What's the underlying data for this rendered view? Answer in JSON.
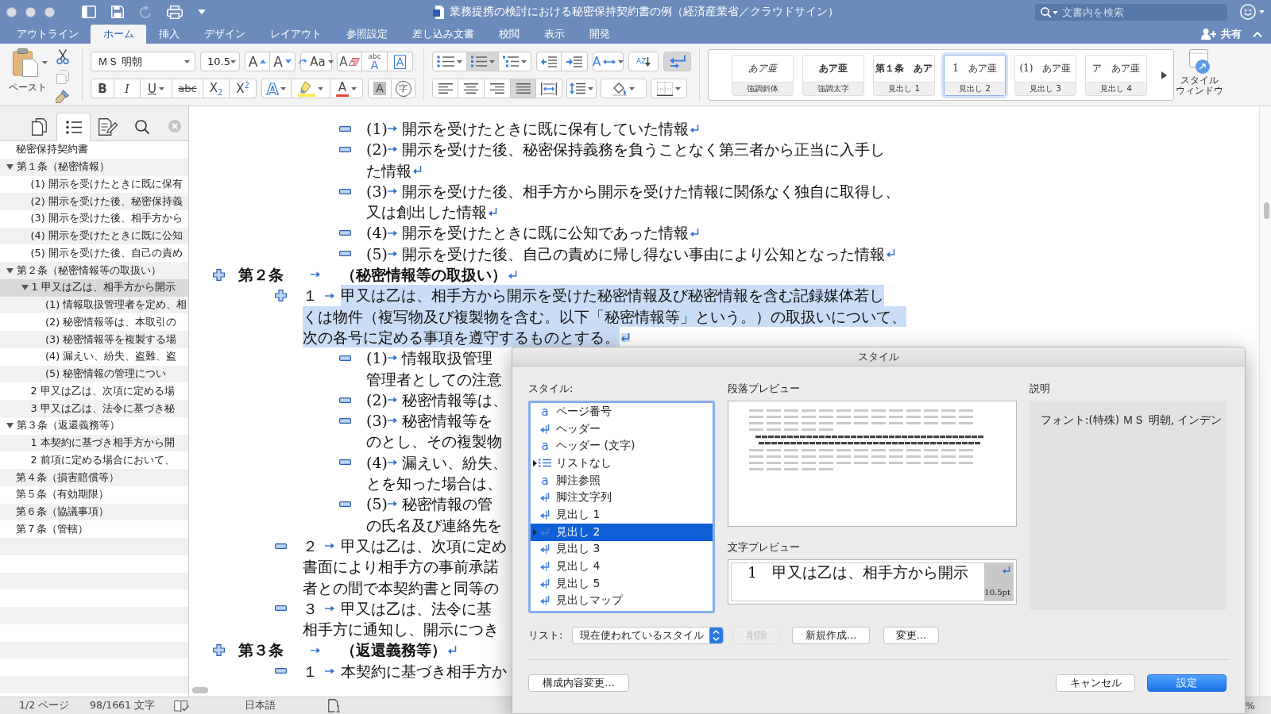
{
  "window": {
    "title": "業務提携の検討における秘密保持契約書の例（経済産業省／クラウドサイン）",
    "search": {
      "placeholder": "文書内を検索"
    }
  },
  "quick_access": [
    {
      "kind": "sidebar",
      "disabled": false
    },
    {
      "kind": "save",
      "disabled": false
    },
    {
      "kind": "undo",
      "disabled": true
    },
    {
      "kind": "print",
      "disabled": false
    },
    {
      "kind": "customize",
      "disabled": false
    }
  ],
  "tabs": [
    {
      "label": "アウトライン",
      "selected": false
    },
    {
      "label": "ホーム",
      "selected": true
    },
    {
      "label": "挿入",
      "selected": false
    },
    {
      "label": "デザイン",
      "selected": false
    },
    {
      "label": "レイアウト",
      "selected": false
    },
    {
      "label": "参照設定",
      "selected": false
    },
    {
      "label": "差し込み文書",
      "selected": false
    },
    {
      "label": "校閲",
      "selected": false
    },
    {
      "label": "表示",
      "selected": false
    },
    {
      "label": "開発",
      "selected": false
    }
  ],
  "share": {
    "label": "共有"
  },
  "ribbon": {
    "paste": {
      "label": "ペースト"
    },
    "font": {
      "name": "ＭＳ 明朝",
      "size": "10.5",
      "row1": [
        [
          {
            "kind": "grow",
            "label": "A"
          },
          {
            "kind": "shrink",
            "label": "A"
          }
        ],
        [
          {
            "kind": "change_case",
            "label": "Aa",
            "dropdown": true
          }
        ],
        [
          {
            "kind": "clear_formatting",
            "label": "A"
          },
          {
            "kind": "phonetic",
            "label": "A",
            "ruby": "abc"
          },
          {
            "kind": "char_border",
            "label": "A"
          }
        ]
      ],
      "row2": [
        [
          {
            "kind": "bold",
            "label": "B",
            "on": false
          },
          {
            "kind": "italic",
            "label": "I",
            "on": false
          },
          {
            "kind": "underline",
            "label": "U",
            "on": false,
            "dropdown": true
          },
          {
            "kind": "strike",
            "label": "abc",
            "on": false
          },
          {
            "kind": "subscript",
            "label": "X$_{2}$",
            "on": false
          },
          {
            "kind": "superscript",
            "label": "X$^{2}$",
            "on": false
          }
        ],
        [
          {
            "kind": "text_effects",
            "label": "A",
            "dropdown": true
          },
          {
            "kind": "highlight",
            "dropdown": true
          },
          {
            "kind": "font_color",
            "label": "A",
            "dropdown": true
          }
        ],
        [
          {
            "kind": "char_shading",
            "label": "A",
            "on": false
          },
          {
            "kind": "enclosed",
            "label": "字"
          }
        ]
      ]
    },
    "paragraph": {
      "row1": [
        [
          {
            "kind": "bullets",
            "dropdown": true,
            "on": false
          },
          {
            "kind": "numbering",
            "dropdown": true,
            "on": true
          },
          {
            "kind": "multilevel",
            "dropdown": true,
            "on": false
          }
        ],
        [
          {
            "kind": "outdent"
          },
          {
            "kind": "indent"
          }
        ],
        [
          {
            "kind": "asian_layout",
            "label": "A",
            "dropdown": true
          }
        ],
        [
          {
            "kind": "sort",
            "label": "AZ"
          }
        ],
        [
          {
            "kind": "show_marks",
            "on": true
          }
        ]
      ],
      "row2": [
        [
          {
            "kind": "align_left",
            "on": false
          },
          {
            "kind": "align_center",
            "on": false
          },
          {
            "kind": "align_right",
            "on": false
          },
          {
            "kind": "justify",
            "on": true
          },
          {
            "kind": "distribute",
            "on": false
          }
        ],
        [
          {
            "kind": "line_spacing",
            "dropdown": true
          }
        ],
        [
          {
            "kind": "shading",
            "dropdown": true
          }
        ],
        [
          {
            "kind": "borders",
            "dropdown": true
          }
        ]
      ]
    },
    "styles": [
      {
        "kind": "italic",
        "preview": "あア亜",
        "label": "強調斜体",
        "selected": false
      },
      {
        "kind": "bold",
        "preview": "あア亜",
        "label": "強調太字",
        "selected": false
      },
      {
        "kind": "bold",
        "preview": "第１条　あア",
        "label": "見出し 1",
        "selected": false
      },
      {
        "kind": "plain",
        "preview": "1　あア亜",
        "label": "見出し 2",
        "selected": true
      },
      {
        "kind": "plain",
        "preview": "(1)　あア亜",
        "label": "見出し 3",
        "selected": false
      },
      {
        "kind": "plain",
        "preview": "ア　あア亜",
        "label": "見出し 4",
        "selected": false
      }
    ],
    "style_window": {
      "label_lines": [
        "スタイル",
        "ウィンドウ"
      ]
    }
  },
  "sidebar": {
    "tabs": [
      {
        "kind": "thumbnails",
        "selected": false
      },
      {
        "kind": "outline",
        "selected": true
      },
      {
        "kind": "review",
        "selected": false
      },
      {
        "kind": "search",
        "selected": false
      }
    ],
    "outline": [
      {
        "text": "秘密保持契約書",
        "selected": false
      },
      {
        "text": "第１条（秘密情報）",
        "expanded": true,
        "selected": false,
        "children": [
          {
            "text": "(1) 開示を受けたときに既に保有",
            "selected": false
          },
          {
            "text": "(2) 開示を受けた後、秘密保持義",
            "selected": false
          },
          {
            "text": "(3) 開示を受けた後、相手方から",
            "selected": false
          },
          {
            "text": "(4) 開示を受けたときに既に公知",
            "selected": false
          },
          {
            "text": "(5) 開示を受けた後、自己の責め",
            "selected": false
          }
        ]
      },
      {
        "text": "第２条（秘密情報等の取扱い）",
        "expanded": true,
        "selected": false,
        "children": [
          {
            "text": "1 甲又は乙は、相手方から開示",
            "expanded": true,
            "selected": true,
            "children": [
              {
                "text": "(1) 情報取扱管理者を定め、相",
                "selected": false
              },
              {
                "text": "(2) 秘密情報等は、本取引の",
                "selected": false
              },
              {
                "text": "(3) 秘密情報等を複製する場",
                "selected": false
              },
              {
                "text": "(4) 漏えい、紛失、盗難、盗",
                "selected": false
              },
              {
                "text": "(5) 秘密情報の管理につい",
                "selected": false
              }
            ]
          },
          {
            "text": "2 甲又は乙は、次項に定める場",
            "selected": false
          },
          {
            "text": "3 甲又は乙は、法令に基づき秘",
            "selected": false
          }
        ]
      },
      {
        "text": "第３条（返還義務等）",
        "expanded": true,
        "selected": false,
        "children": [
          {
            "text": "1 本契約に基づき相手方から開",
            "selected": false
          },
          {
            "text": "2 前項に定める場合において、",
            "selected": false
          }
        ]
      },
      {
        "text": "第４条（損害賠償等）",
        "selected": false
      },
      {
        "text": "第５条（有効期限）",
        "selected": false
      },
      {
        "text": "第６条（協議事項）",
        "selected": false
      },
      {
        "text": "第７条（管轄）",
        "selected": false
      }
    ]
  },
  "document": {
    "blocks": [
      {
        "kind": "item",
        "has_subtext": false,
        "number": "(1)",
        "lines": [
          "開示を受けたときに既に保有していた情報"
        ],
        "end_mark": true,
        "selected": false
      },
      {
        "kind": "item",
        "has_subtext": false,
        "number": "(2)",
        "lines": [
          "開示を受けた後、秘密保持義務を負うことなく第三者から正当に入手し",
          "た情報"
        ],
        "end_mark": true,
        "selected": false
      },
      {
        "kind": "item",
        "has_subtext": false,
        "number": "(3)",
        "lines": [
          "開示を受けた後、相手方から開示を受けた情報に関係なく独自に取得し、",
          "又は創出した情報"
        ],
        "end_mark": true,
        "selected": false
      },
      {
        "kind": "item",
        "has_subtext": false,
        "number": "(4)",
        "lines": [
          "開示を受けたときに既に公知であった情報"
        ],
        "end_mark": true,
        "selected": false
      },
      {
        "kind": "item",
        "has_subtext": false,
        "number": "(5)",
        "lines": [
          "開示を受けた後、自己の責めに帰し得ない事由により公知となった情報"
        ],
        "end_mark": true,
        "selected": false
      },
      {
        "kind": "heading",
        "has_subtext": true,
        "number": "第２条",
        "lines": [
          "（秘密情報等の取扱い）"
        ],
        "end_mark": true,
        "selected": false
      },
      {
        "kind": "para",
        "has_subtext": true,
        "number": "１",
        "lines": [
          "甲又は乙は、相手方から開示を受けた秘密情報及び秘密情報を含む記録媒体若し",
          "くは物件（複写物及び複製物を含む。以下「秘密情報等」という。）の取扱いについて、",
          "次の各号に定める事項を遵守するものとする。"
        ],
        "end_mark": true,
        "selected": true
      },
      {
        "kind": "item",
        "has_subtext": false,
        "number": "(1)",
        "lines": [
          "情報取扱管理",
          "管理者としての注意"
        ],
        "end_mark": false,
        "selected": false
      },
      {
        "kind": "item",
        "has_subtext": false,
        "number": "(2)",
        "lines": [
          "秘密情報等は、"
        ],
        "end_mark": false,
        "selected": false
      },
      {
        "kind": "item",
        "has_subtext": false,
        "number": "(3)",
        "lines": [
          "秘密情報等を",
          "のとし、その複製物"
        ],
        "end_mark": false,
        "selected": false
      },
      {
        "kind": "item",
        "has_subtext": false,
        "number": "(4)",
        "lines": [
          "漏えい、紛失、",
          "とを知った場合は、"
        ],
        "end_mark": false,
        "selected": false
      },
      {
        "kind": "item",
        "has_subtext": false,
        "number": "(5)",
        "lines": [
          "秘密情報の管",
          "の氏名及び連絡先を"
        ],
        "end_mark": false,
        "selected": false
      },
      {
        "kind": "para",
        "has_subtext": false,
        "number": "２",
        "lines": [
          "甲又は乙は、次項に定め",
          "書面により相手方の事前承諾",
          "者との間で本契約書と同等の"
        ],
        "end_mark": false,
        "selected": false
      },
      {
        "kind": "para",
        "has_subtext": false,
        "number": "３",
        "lines": [
          "甲又は乙は、法令に基",
          "相手方に通知し、開示につき"
        ],
        "end_mark": false,
        "selected": false
      },
      {
        "kind": "heading",
        "has_subtext": true,
        "number": "第３条",
        "lines": [
          "（返還義務等）"
        ],
        "end_mark": true,
        "selected": false
      },
      {
        "kind": "para",
        "has_subtext": false,
        "number": "１",
        "lines": [
          "本契約に基づき相手方か"
        ],
        "end_mark": false,
        "selected": false
      }
    ]
  },
  "status_bar": {
    "page": "1/2 ページ",
    "words": "98/1661 文字",
    "language": "日本語",
    "zoom": "%"
  },
  "dialog": {
    "title": "スタイル",
    "styles_label": "スタイル:",
    "styles": [
      {
        "kind": "character",
        "glyph": "a",
        "name": "ページ番号",
        "expandable": false,
        "selected": false
      },
      {
        "kind": "paragraph",
        "name": "ヘッダー",
        "expandable": false,
        "selected": false
      },
      {
        "kind": "character",
        "glyph": "a",
        "name": "ヘッダー (文字)",
        "expandable": false,
        "selected": false
      },
      {
        "kind": "list",
        "name": "リストなし",
        "expandable": true,
        "selected": false
      },
      {
        "kind": "character",
        "glyph": "a",
        "name": "脚注参照",
        "expandable": false,
        "selected": false
      },
      {
        "kind": "paragraph",
        "name": "脚注文字列",
        "expandable": false,
        "selected": false
      },
      {
        "kind": "paragraph",
        "name": "見出し 1",
        "expandable": false,
        "selected": false
      },
      {
        "kind": "paragraph",
        "name": "見出し 2",
        "expandable": true,
        "selected": true
      },
      {
        "kind": "paragraph",
        "name": "見出し 3",
        "expandable": false,
        "selected": false
      },
      {
        "kind": "paragraph",
        "name": "見出し 4",
        "expandable": false,
        "selected": false
      },
      {
        "kind": "paragraph",
        "name": "見出し 5",
        "expandable": false,
        "selected": false
      },
      {
        "kind": "paragraph",
        "name": "見出しマップ",
        "expandable": false,
        "selected": false
      }
    ],
    "paragraph_preview_label": "段落プレビュー",
    "character_preview_label": "文字プレビュー",
    "character_preview": {
      "text": "1　甲又は乙は、相手方から開示",
      "size": "10.5pt"
    },
    "description_label": "説明",
    "description": "フォント:(特殊) ＭＳ 明朝, インデン",
    "list_label": "リスト:",
    "list_value": "現在使われているスタイル",
    "buttons": [
      {
        "kind": "delete",
        "label": "削除",
        "disabled": true
      },
      {
        "kind": "new",
        "label": "新規作成...",
        "disabled": false
      },
      {
        "kind": "modify",
        "label": "変更...",
        "disabled": false
      }
    ],
    "footer_buttons": [
      {
        "kind": "organizer",
        "label": "構成内容変更...",
        "default": false
      },
      {
        "kind": "cancel",
        "label": "キャンセル",
        "default": false
      },
      {
        "kind": "ok",
        "label": "設定",
        "default": true
      }
    ]
  }
}
